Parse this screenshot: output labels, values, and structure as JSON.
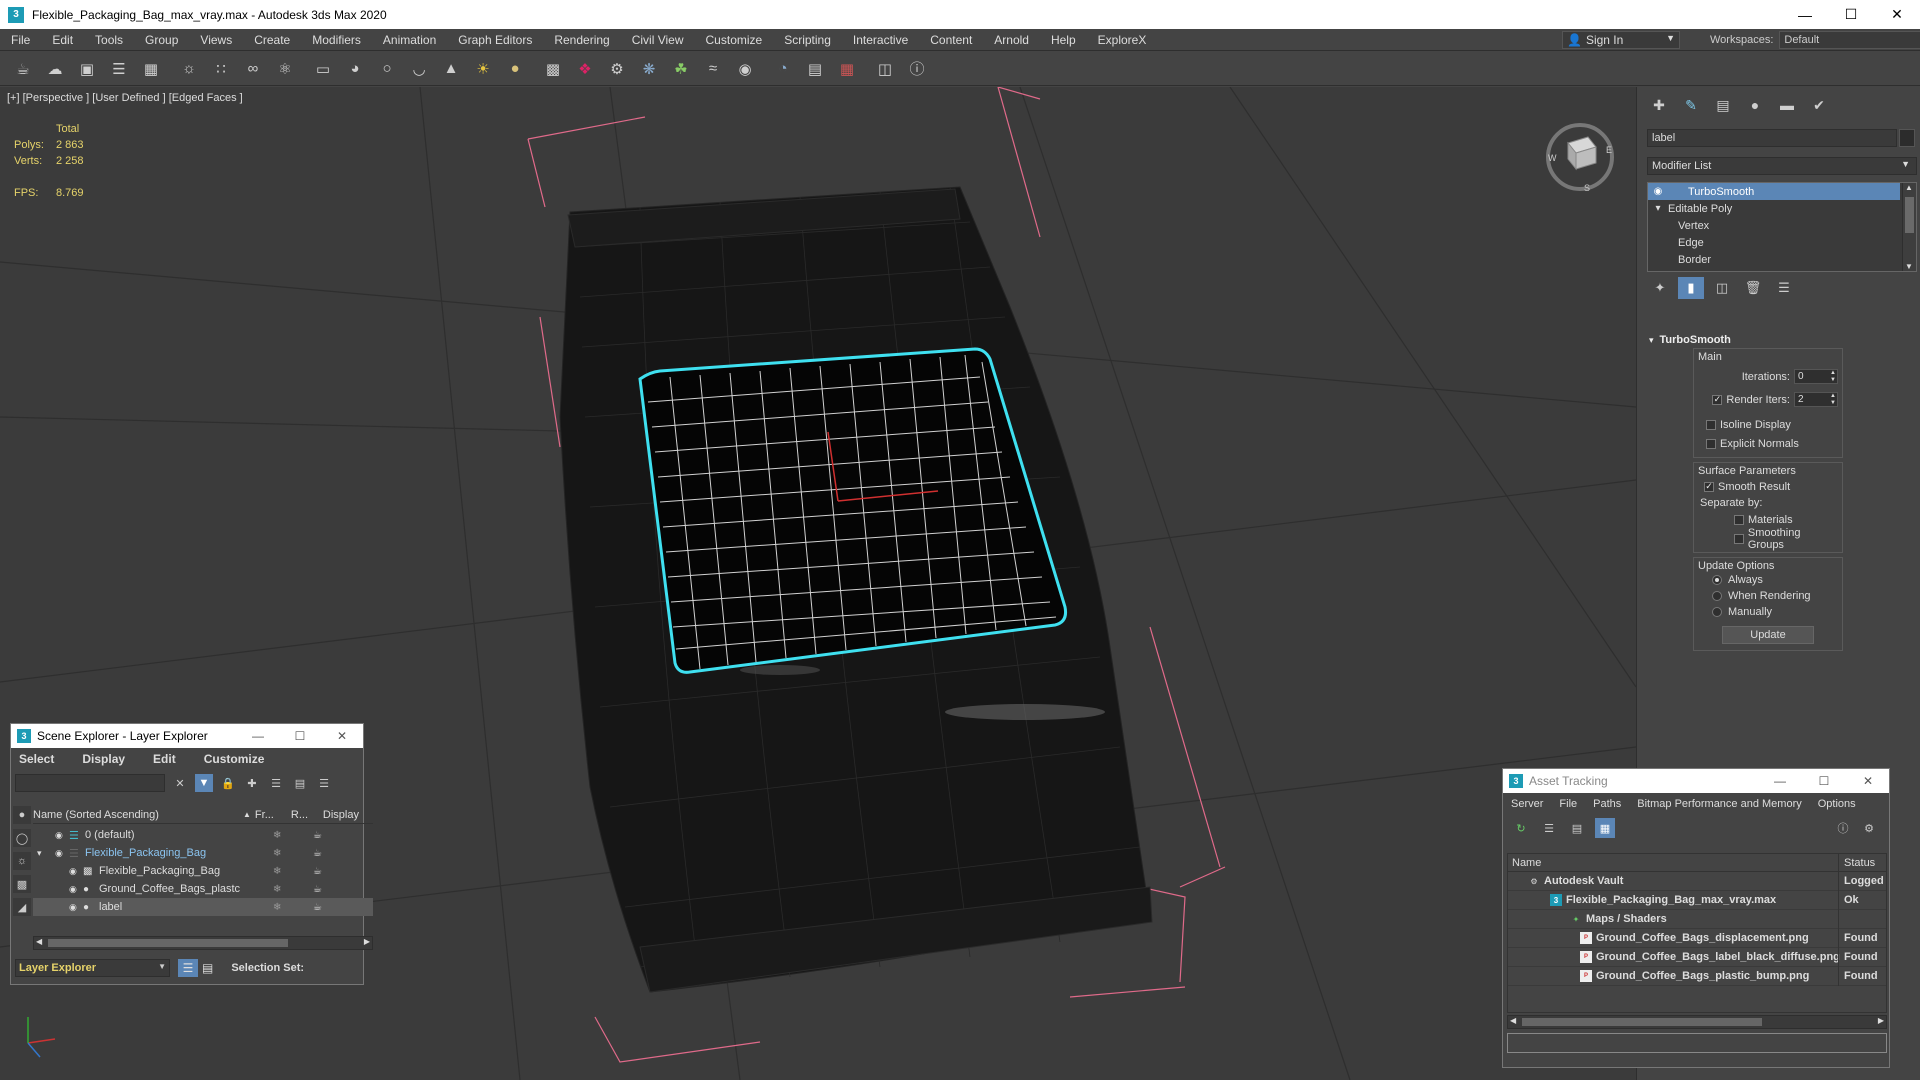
{
  "window": {
    "title": "Flexible_Packaging_Bag_max_vray.max - Autodesk 3ds Max 2020",
    "app_icon": "3"
  },
  "menu": [
    "File",
    "Edit",
    "Tools",
    "Group",
    "Views",
    "Create",
    "Modifiers",
    "Animation",
    "Graph Editors",
    "Rendering",
    "Civil View",
    "Customize",
    "Scripting",
    "Interactive",
    "Content",
    "Arnold",
    "Help",
    "ExploreX"
  ],
  "signin": {
    "label": "Sign In"
  },
  "workspaces": {
    "label": "Workspaces:",
    "value": "Default"
  },
  "toolbar_icons": [
    "teapot-icon",
    "cloud-icon",
    "render-frame-icon",
    "list-icon",
    "table-icon",
    "bulb-icon",
    "particles-icon",
    "spring-icon",
    "atom-icon",
    "box-icon",
    "dome-icon",
    "sphere-icon",
    "bowl-icon",
    "cone-icon",
    "sun-icon",
    "disc-icon",
    "mesh-icon",
    "bones-icon",
    "robot-icon",
    "globe-icon",
    "plant-icon",
    "hair-icon",
    "texture-icon",
    "world-icon",
    "image-icon",
    "render-icon",
    "book-icon",
    "help-icon"
  ],
  "viewport": {
    "label": "[+] [Perspective ] [User Defined ] [Edged Faces ]",
    "stats": {
      "total_label": "Total",
      "polys_label": "Polys:",
      "polys_value": "2 863",
      "verts_label": "Verts:",
      "verts_value": "2 258",
      "fps_label": "FPS:",
      "fps_value": "8.769"
    }
  },
  "command_panel": {
    "object_name": "label",
    "modifier_list_label": "Modifier List",
    "stack": [
      {
        "label": "TurboSmooth",
        "selected": true
      },
      {
        "label": "Editable Poly",
        "selected": false
      },
      {
        "label": "Vertex",
        "selected": false
      },
      {
        "label": "Edge",
        "selected": false
      },
      {
        "label": "Border",
        "selected": false
      }
    ],
    "turbosmooth": {
      "title": "TurboSmooth",
      "main_label": "Main",
      "iterations_label": "Iterations:",
      "iterations_value": "0",
      "render_iters_label": "Render Iters:",
      "render_iters_value": "2",
      "isoline_label": "Isoline Display",
      "explicit_normals_label": "Explicit Normals",
      "surface_params_label": "Surface Parameters",
      "smooth_result_label": "Smooth Result",
      "separate_by_label": "Separate by:",
      "materials_label": "Materials",
      "smoothing_groups_label": "Smoothing Groups",
      "update_options_label": "Update Options",
      "always_label": "Always",
      "when_rendering_label": "When Rendering",
      "manually_label": "Manually",
      "update_button": "Update"
    }
  },
  "scene_explorer": {
    "title": "Scene Explorer - Layer Explorer",
    "menu": [
      "Select",
      "Display",
      "Edit",
      "Customize"
    ],
    "columns": {
      "name": "Name (Sorted Ascending)",
      "frozen": "Fr...",
      "render": "R...",
      "display": "Display"
    },
    "rows": [
      {
        "name": "0 (default)"
      },
      {
        "name": "Flexible_Packaging_Bag"
      },
      {
        "name": "Flexible_Packaging_Bag"
      },
      {
        "name": "Ground_Coffee_Bags_plastc"
      },
      {
        "name": "label"
      }
    ],
    "layer_explorer_label": "Layer Explorer",
    "selection_set_label": "Selection Set:"
  },
  "asset_tracking": {
    "title": "Asset Tracking",
    "menu": [
      "Server",
      "File",
      "Paths",
      "Bitmap Performance and Memory",
      "Options"
    ],
    "columns": {
      "name": "Name",
      "status": "Status"
    },
    "rows": [
      {
        "name": "Autodesk Vault",
        "status": "Logged"
      },
      {
        "name": "Flexible_Packaging_Bag_max_vray.max",
        "status": "Ok"
      },
      {
        "name": "Maps / Shaders",
        "status": ""
      },
      {
        "name": "Ground_Coffee_Bags_displacement.png",
        "status": "Found"
      },
      {
        "name": "Ground_Coffee_Bags_label_black_diffuse.png",
        "status": "Found"
      },
      {
        "name": "Ground_Coffee_Bags_plastic_bump.png",
        "status": "Found"
      }
    ]
  },
  "colors": {
    "accent": "#5b86b6",
    "selection_outline": "#3fe0f0",
    "stats": "#e6d36a",
    "bounding_box": "#e06a8a"
  }
}
